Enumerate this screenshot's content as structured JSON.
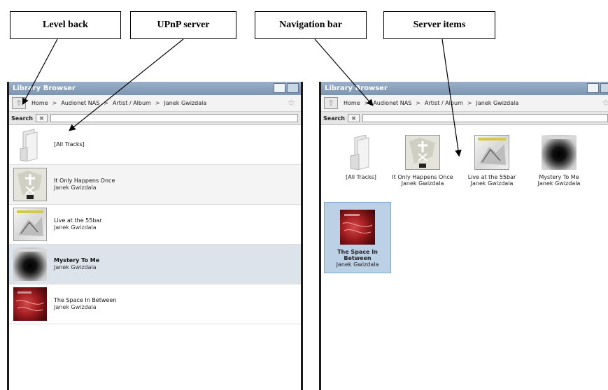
{
  "callouts": {
    "level_back": "Level back",
    "upnp_server": "UPnP server",
    "navigation_bar": "Navigation bar",
    "server_items": "Server items"
  },
  "library": {
    "title": "Library Browser",
    "breadcrumb": [
      "Home",
      "Audionet NAS",
      "Artist / Album",
      "Janek Gwizdala"
    ],
    "breadcrumb_separator": ">",
    "search_label": "Search",
    "search_value": "",
    "icons": {
      "back": "up-arrow-icon",
      "favorite": "star-icon",
      "clear": "clear-icon",
      "list_view": "list-view-icon",
      "grid_view": "grid-view-icon"
    }
  },
  "items": [
    {
      "title": "[All Tracks]",
      "artist": "",
      "cover": "folder-icon"
    },
    {
      "title": "It Only Happens Once",
      "artist": "Janek Gwizdala",
      "cover": "album-cover"
    },
    {
      "title": "Live at the 55bar",
      "artist": "Janek Gwizdala",
      "cover": "album-cover"
    },
    {
      "title": "Mystery To Me",
      "artist": "Janek Gwizdala",
      "cover": "album-cover"
    },
    {
      "title": "The Space In Between",
      "artist": "Janek Gwizdala",
      "cover": "album-cover"
    }
  ],
  "grid_items": [
    {
      "title": "[All Tracks]",
      "artist": ""
    },
    {
      "title": "It Only Happens Once",
      "artist": "Janek Gwizdala"
    },
    {
      "title": "Live at the 55bar",
      "artist": "Janek Gwizdala"
    },
    {
      "title": "Mystery To Me",
      "artist": "Janek Gwizdala"
    },
    {
      "title": "The Space In Between",
      "artist": "Janek Gwizdala"
    }
  ],
  "selection": {
    "list_selected_index": 3,
    "grid_selected_index": 4
  },
  "colors": {
    "titlebar": "#8aa0bb",
    "selected_row": "#dde3ea",
    "selected_tile": "#bcd0e6"
  }
}
